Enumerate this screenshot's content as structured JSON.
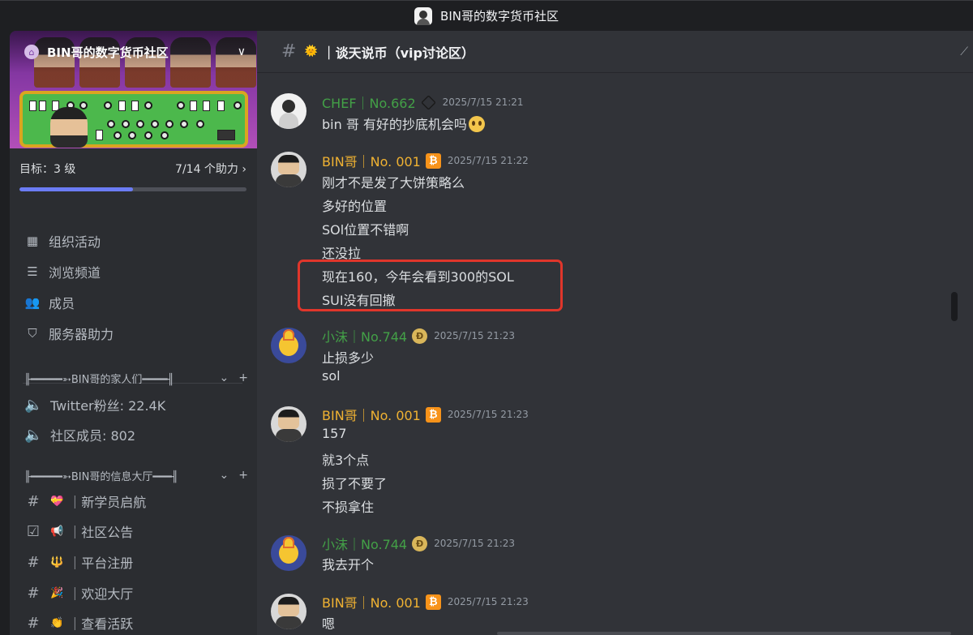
{
  "window": {
    "title": "BIN哥的数字货币社区"
  },
  "server": {
    "name": "BIN哥的数字货币社区"
  },
  "boost": {
    "goal": "目标：3 级",
    "progress_label": "7/14 个助力",
    "progress_fraction": 0.5
  },
  "nav": [
    {
      "label": "组织活动"
    },
    {
      "label": "浏览频道"
    },
    {
      "label": "成员"
    },
    {
      "label": "服务器助力"
    }
  ],
  "categories": [
    {
      "name": "╟━━━━━➳BIN哥的家人们━━━━╢"
    },
    {
      "name": "╟━━━━━➳BIN哥的信息大厅━━━╢"
    }
  ],
  "voice_channels": [
    {
      "label": "Twitter粉丝: 22.4K"
    },
    {
      "label": "社区成员: 802"
    }
  ],
  "text_channels": [
    {
      "emoji": "💝",
      "label": "｜新学员启航"
    },
    {
      "emoji": "📢",
      "label": "｜社区公告"
    },
    {
      "emoji": "🔱",
      "label": "｜平台注册"
    },
    {
      "emoji": "🎉",
      "label": "｜欢迎大厅"
    },
    {
      "emoji": "👏",
      "label": "｜查看活跃"
    }
  ],
  "channel": {
    "emoji": "🌞",
    "title": "｜谈天说币（vip讨论区）"
  },
  "messages": [
    {
      "author": "CHEF｜No.662",
      "time": "2025/7/15 21:21",
      "lines": [
        "bin 哥  有好的抄底机会吗"
      ]
    },
    {
      "author": "BIN哥｜No. 001",
      "time": "2025/7/15 21:22",
      "lines": [
        "刚才不是发了大饼策略么",
        "多好的位置",
        "SOl位置不错啊",
        "还没拉",
        "现在160，今年会看到300的SOL",
        "SUI没有回撤"
      ]
    },
    {
      "author": "小沫｜No.744",
      "time": "2025/7/15 21:23",
      "lines": [
        "止损多少",
        "sol"
      ]
    },
    {
      "author": "BIN哥｜No. 001",
      "time": "2025/7/15 21:23",
      "lines": [
        "157",
        "就3个点",
        "损了不要了",
        "不损拿住"
      ]
    },
    {
      "author": "小沫｜No.744",
      "time": "2025/7/15 21:23",
      "lines": [
        "我去开个"
      ]
    },
    {
      "author": "BIN哥｜No. 001",
      "time": "2025/7/15 21:23",
      "lines": [
        "嗯"
      ]
    }
  ],
  "colors": {
    "accent": "#6b7cf5",
    "highlight": "#e0362b",
    "green_name": "#43a047",
    "gold_name": "#f0b232"
  },
  "icons": {
    "btc": "₿"
  }
}
